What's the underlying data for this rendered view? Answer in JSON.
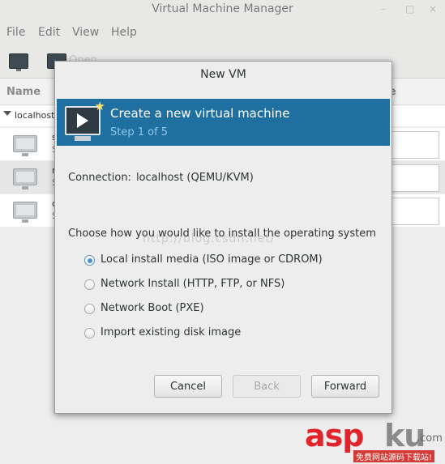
{
  "app": {
    "window_title": "Virtual Machine Manager",
    "window_controls": [
      "–",
      "□",
      "×"
    ]
  },
  "menubar": [
    "File",
    "Edit",
    "View",
    "Help"
  ],
  "toolbar": {
    "open_label": "Open"
  },
  "list": {
    "header_name": "Name",
    "header_usage": "e",
    "group_label": "localhost",
    "rows": [
      {
        "name": "s",
        "status": "S"
      },
      {
        "name": "r",
        "status": "S"
      },
      {
        "name": "c",
        "status": "S"
      }
    ]
  },
  "dialog": {
    "title": "New VM",
    "banner_title": "Create a new virtual machine",
    "banner_step": "Step 1 of 5",
    "connection_label": "Connection:",
    "connection_value": "localhost (QEMU/KVM)",
    "choose_label": "Choose how you would like to install the operating system",
    "watermark_text": "http://blog.csdn.net/",
    "options": [
      {
        "label": "Local install media (ISO image or CDROM)",
        "selected": true
      },
      {
        "label": "Network Install (HTTP, FTP, or NFS)",
        "selected": false
      },
      {
        "label": "Network Boot (PXE)",
        "selected": false
      },
      {
        "label": "Import existing disk image",
        "selected": false
      }
    ],
    "buttons": {
      "cancel": "Cancel",
      "back": "Back",
      "forward": "Forward"
    }
  },
  "logo": {
    "asp": "asp",
    "ku": "ku",
    "com": ".com",
    "sub": "免费网站源码下载站!"
  },
  "colors": {
    "banner": "#1f6fa0",
    "radio_selected": "#4a90d9",
    "logo_red": "#e0242a"
  }
}
